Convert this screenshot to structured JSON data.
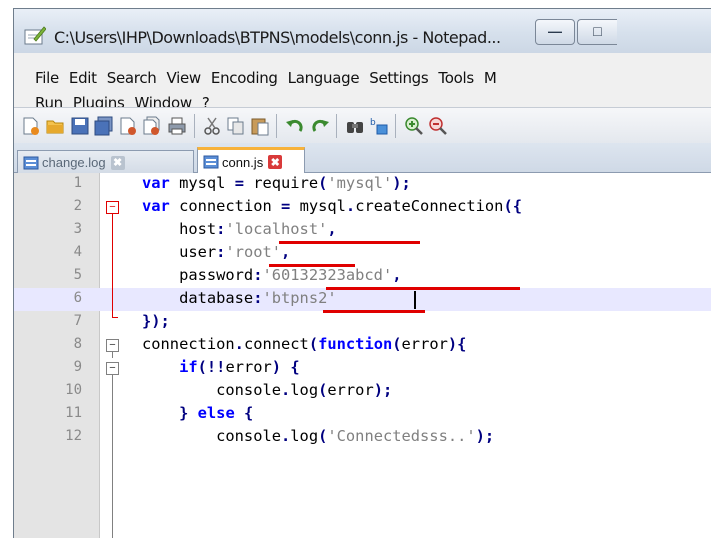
{
  "window": {
    "title": "C:\\Users\\IHP\\Downloads\\BTPNS\\models\\conn.js - Notepad...",
    "minimize_glyph": "—",
    "maximize_glyph": "□"
  },
  "menu": {
    "row1": [
      "File",
      "Edit",
      "Search",
      "View",
      "Encoding",
      "Language",
      "Settings",
      "Tools",
      "M"
    ],
    "row2": [
      "Run",
      "Plugins",
      "Window",
      "?"
    ]
  },
  "toolbar": {
    "icons": [
      "new-file-icon",
      "open-file-icon",
      "save-icon",
      "save-all-icon",
      "close-icon",
      "close-all-icon",
      "print-icon",
      "cut-icon",
      "copy-icon",
      "paste-icon",
      "undo-icon",
      "redo-icon",
      "find-icon",
      "replace-icon",
      "zoom-in-icon",
      "zoom-out-icon"
    ]
  },
  "tabs": [
    {
      "label": "change.log",
      "active": false,
      "close": "✖"
    },
    {
      "label": "conn.js",
      "active": true,
      "close": "✖"
    }
  ],
  "editor": {
    "line_numbers": [
      "1",
      "2",
      "3",
      "4",
      "5",
      "6",
      "7",
      "8",
      "9",
      "10",
      "11",
      "12"
    ],
    "current_line": 6,
    "colors": {
      "keyword": "#0000ff",
      "string": "#808080",
      "fold_highlight": "#e00000",
      "current_line_bg": "#e8e8ff",
      "tab_accent": "#f7b23b"
    }
  }
}
